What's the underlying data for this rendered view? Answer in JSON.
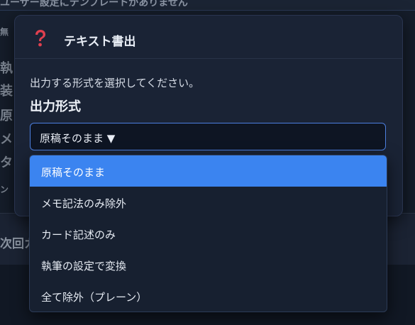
{
  "background": {
    "top_text": "ユーザー設定にテンプレートがありません",
    "side_fragments": [
      "無",
      "執",
      "装",
      "原",
      "メ",
      "タ",
      "ン"
    ],
    "band_text": "次回カ"
  },
  "dialog": {
    "title": "テキスト書出",
    "icon": "question-icon",
    "message": "出力する形式を選択してください。",
    "field_label": "出力形式",
    "selected_value": "原稿そのまま ▼",
    "options": [
      "原稿そのまま",
      "メモ記法のみ除外",
      "カード記述のみ",
      "執筆の設定で変換",
      "全て除外（プレーン）"
    ],
    "selected_index": 0
  },
  "colors": {
    "accent": "#3b84f0",
    "icon_red": "#e0404f",
    "dialog_bg": "#1a2335",
    "dropdown_bg": "#172030"
  }
}
